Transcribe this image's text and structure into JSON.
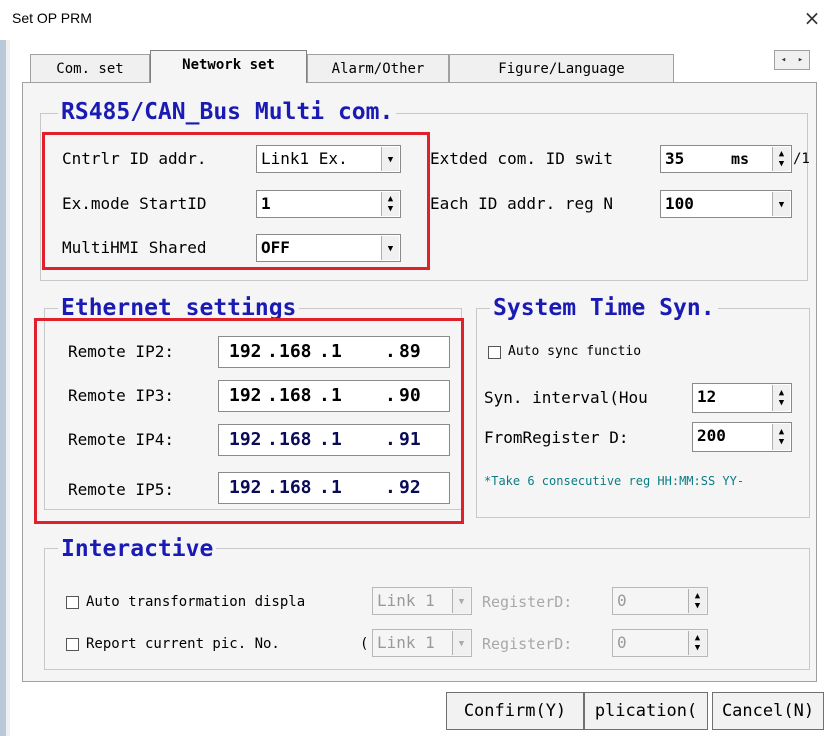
{
  "window": {
    "title": "Set OP PRM",
    "close_glyph": "×"
  },
  "tabs": [
    {
      "label": "Com. set",
      "active": false
    },
    {
      "label": "Network set",
      "active": true
    },
    {
      "label": "Alarm/Other",
      "active": false
    },
    {
      "label": "Figure/Language",
      "active": false
    }
  ],
  "tab_scroll": {
    "left": "◂",
    "right": "▸"
  },
  "rs485": {
    "title": "RS485/CAN_Bus Multi com.",
    "cntrlr_label": "Cntrlr ID addr.",
    "cntrlr_value": "Link1 Ex.",
    "startid_label": "Ex.mode StartID",
    "startid_value": "1",
    "shared_label": "MultiHMI Shared",
    "shared_value": "OFF",
    "extded_label": "Extded com. ID swit",
    "extded_value": "35",
    "extded_unit": "ms",
    "extded_suffix": "/1",
    "reg_label": "Each ID addr. reg N",
    "reg_value": "100"
  },
  "ethernet": {
    "title": "Ethernet settings",
    "rows": [
      {
        "label": "Remote IP2:",
        "o1": "192",
        "o2": "168",
        "o3": "1",
        "o4": "89"
      },
      {
        "label": "Remote IP3:",
        "o1": "192",
        "o2": "168",
        "o3": "1",
        "o4": "90"
      },
      {
        "label": "Remote IP4:",
        "o1": "192",
        "o2": "168",
        "o3": "1",
        "o4": "91"
      },
      {
        "label": "Remote IP5:",
        "o1": "192",
        "o2": "168",
        "o3": "1",
        "o4": "92"
      }
    ]
  },
  "systime": {
    "title": "System Time Syn.",
    "auto_sync_label": "Auto sync functio",
    "interval_label": "Syn. interval(Hou",
    "interval_value": "12",
    "from_label": "FromRegister D:",
    "from_value": "200",
    "note": "*Take 6 consecutive reg HH:MM:SS YY-"
  },
  "interactive": {
    "title": "Interactive",
    "row1_label": "Auto transformation displa",
    "row1_link": "Link 1",
    "row1_reg_label": "RegisterD:",
    "row1_reg_value": "0",
    "row2_label": "Report current pic. No.",
    "row2_prefix": "(",
    "row2_link": "Link 1",
    "row2_reg_label": "RegisterD:",
    "row2_reg_value": "0"
  },
  "buttons": {
    "confirm": "Confirm(Y)",
    "application": "plication(",
    "cancel": "Cancel(N)"
  },
  "colors": {
    "group_title": "#1a1ab5",
    "highlight": "#e0202a",
    "note": "#0a7d84",
    "ip_dark": "#000000",
    "ip_blue": "#0a0a5a"
  }
}
